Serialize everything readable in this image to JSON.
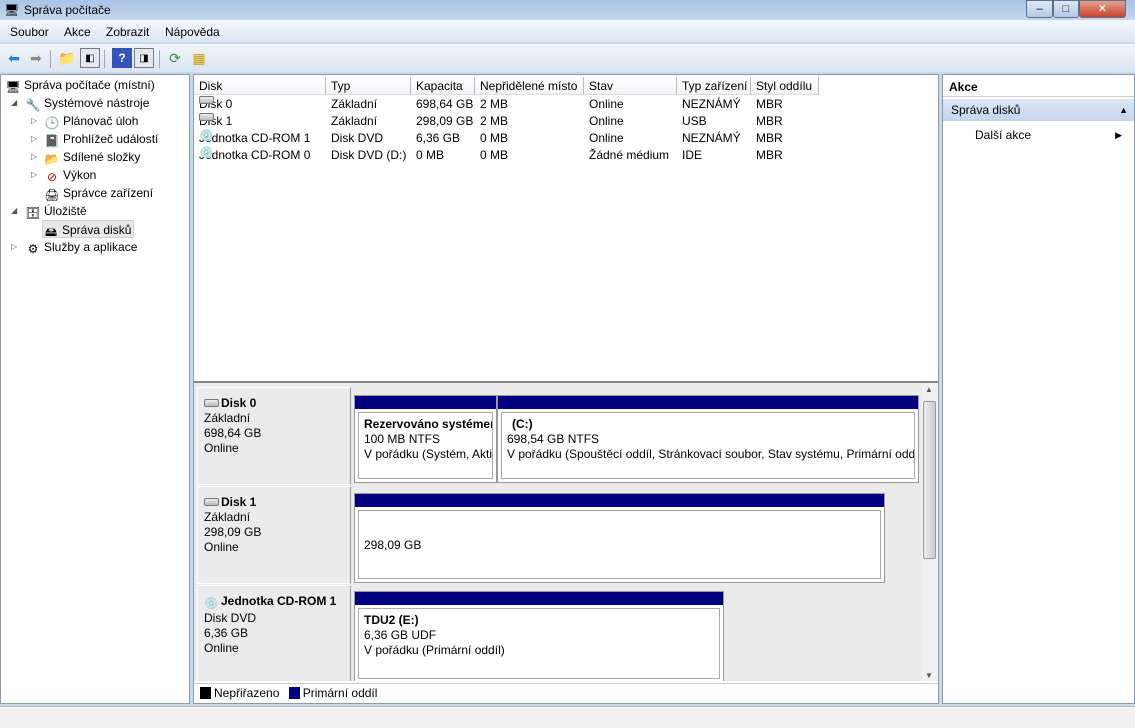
{
  "window": {
    "title": "Správa počítače",
    "minimize": "‒",
    "maximize": "□",
    "close": "✕"
  },
  "menu": [
    "Soubor",
    "Akce",
    "Zobrazit",
    "Nápověda"
  ],
  "tree": {
    "root": "Správa počítače (místní)",
    "items": [
      {
        "label": "Systémové nástroje",
        "level": 1,
        "arrow": "◢"
      },
      {
        "label": "Plánovač úloh",
        "level": 2,
        "arrow": "▷"
      },
      {
        "label": "Prohlížeč událostí",
        "level": 2,
        "arrow": "▷"
      },
      {
        "label": "Sdílené složky",
        "level": 2,
        "arrow": "▷"
      },
      {
        "label": "Výkon",
        "level": 2,
        "arrow": "▷"
      },
      {
        "label": "Správce zařízení",
        "level": 2,
        "arrow": ""
      },
      {
        "label": "Úložiště",
        "level": 1,
        "arrow": "◢"
      },
      {
        "label": "Správa disků",
        "level": 2,
        "arrow": "",
        "selected": true
      },
      {
        "label": "Služby a aplikace",
        "level": 1,
        "arrow": "▷"
      }
    ]
  },
  "volume_list": {
    "columns": [
      "Disk",
      "Typ",
      "Kapacita",
      "Nepřidělené místo",
      "Stav",
      "Typ zařízení",
      "Styl oddílu"
    ],
    "rows": [
      [
        "Disk 0",
        "Základní",
        "698,64 GB",
        "2 MB",
        "Online",
        "NEZNÁMÝ",
        "MBR"
      ],
      [
        "Disk 1",
        "Základní",
        "298,09 GB",
        "2 MB",
        "Online",
        "USB",
        "MBR"
      ],
      [
        "Jednotka CD-ROM 1",
        "Disk DVD",
        "6,36 GB",
        "0 MB",
        "Online",
        "NEZNÁMÝ",
        "MBR"
      ],
      [
        "Jednotka CD-ROM 0",
        "Disk DVD (D:)",
        "0 MB",
        "0 MB",
        "Žádné médium",
        "IDE",
        "MBR"
      ]
    ]
  },
  "disks": [
    {
      "name": "Disk 0",
      "type": "Základní",
      "size": "698,64 GB",
      "status": "Online",
      "partitions": [
        {
          "title": "Rezervováno systémem",
          "line2": "100 MB NTFS",
          "line3": "V pořádku (Systém, Aktivní, Primární oddíl)"
        },
        {
          "title": "(C:)",
          "line2": "698,54 GB NTFS",
          "line3": "V pořádku (Spouštěcí oddíl, Stránkovací soubor, Stav systému, Primární oddíl)"
        }
      ]
    },
    {
      "name": "Disk 1",
      "type": "Základní",
      "size": "298,09 GB",
      "status": "Online",
      "partitions": [
        {
          "title": "",
          "line2": "298,09 GB",
          "line3": ""
        }
      ]
    },
    {
      "name": "Jednotka CD-ROM 1",
      "type": "Disk DVD",
      "size": "6,36 GB",
      "status": "Online",
      "partitions": [
        {
          "title": "TDU2  (E:)",
          "line2": "6,36 GB UDF",
          "line3": "V pořádku (Primární oddíl)"
        }
      ]
    }
  ],
  "legend": [
    {
      "label": "Nepřiřazeno",
      "color": "#000000"
    },
    {
      "label": "Primární oddíl",
      "color": "#000080"
    }
  ],
  "actions": {
    "header": "Akce",
    "section": "Správa disků",
    "items": [
      "Další akce"
    ]
  }
}
